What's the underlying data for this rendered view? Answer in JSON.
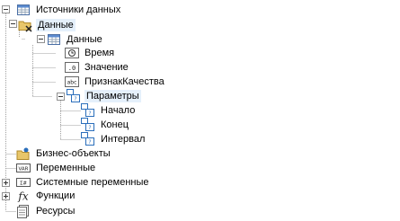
{
  "tree": {
    "root": "Источники данных",
    "connection": "Данные",
    "datasource": "Данные",
    "columns": [
      "Время",
      "Значение",
      "ПризнакКачества"
    ],
    "params_group": "Параметры",
    "params": [
      "Начало",
      "Конец",
      "Интервал"
    ],
    "business_objects": "Бизнес-объекты",
    "variables": "Переменные",
    "system_variables": "Системные переменные",
    "functions": "Функции",
    "resources": "Ресурсы"
  },
  "colors": {
    "selection": "#e5f0fb",
    "lines": "#a0a0a0",
    "icon_blue": "#2a6ebb"
  },
  "icons": {
    "column_time": "clock-icon",
    "column_value": "decimal-icon",
    "column_quality": "abc-text-icon",
    "parameter": "parameter-icon",
    "variables": "var-icon",
    "system_variables": "sys-var-icon",
    "functions": "fx-icon"
  }
}
